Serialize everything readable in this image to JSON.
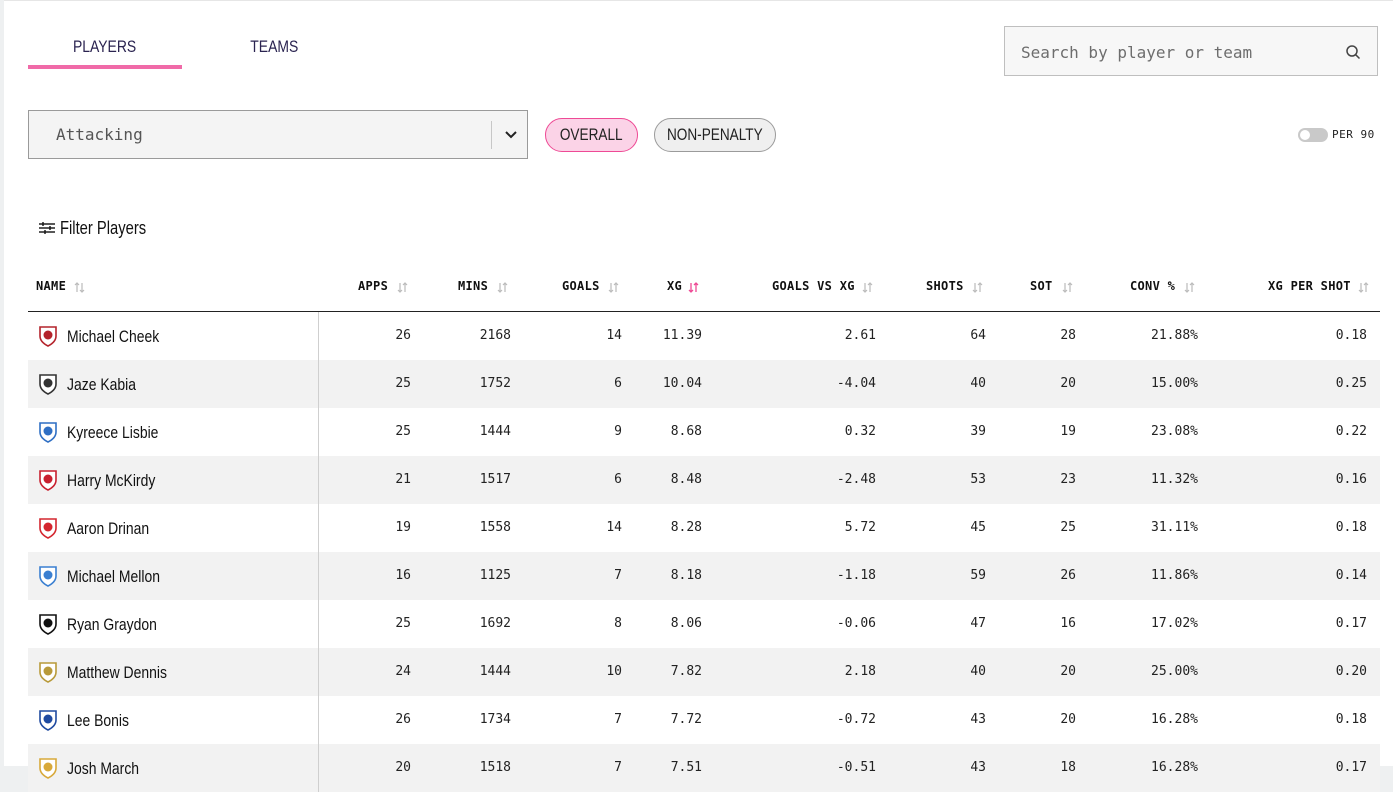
{
  "tabs": [
    {
      "label": "PLAYERS",
      "active": true
    },
    {
      "label": "TEAMS",
      "active": false
    }
  ],
  "search": {
    "placeholder": "Search by player or team"
  },
  "dropdown": {
    "selected": "Attacking"
  },
  "pills": {
    "overall": "OVERALL",
    "non_penalty": "NON-PENALTY"
  },
  "toggle": {
    "label": "PER 90",
    "on": false
  },
  "filter": {
    "label": "Filter Players"
  },
  "columns": {
    "name": "NAME",
    "apps": "APPS",
    "mins": "MINS",
    "goals": "GOALS",
    "xg": "XG",
    "goals_vs_xg": "GOALS VS XG",
    "shots": "SHOTS",
    "sot": "SOT",
    "conv": "CONV %",
    "xg_per_shot": "XG PER SHOT"
  },
  "sorted_by": "XG",
  "accent_color": "#ee4a95",
  "rows": [
    {
      "name": "Michael Cheek",
      "crest": "#b4232b",
      "apps": "26",
      "mins": "2168",
      "goals": "14",
      "xg": "11.39",
      "gvx": "2.61",
      "shots": "64",
      "sot": "28",
      "conv": "21.88%",
      "xgps": "0.18"
    },
    {
      "name": "Jaze Kabia",
      "crest": "#333333",
      "apps": "25",
      "mins": "1752",
      "goals": "6",
      "xg": "10.04",
      "gvx": "-4.04",
      "shots": "40",
      "sot": "20",
      "conv": "15.00%",
      "xgps": "0.25"
    },
    {
      "name": "Kyreece Lisbie",
      "crest": "#2f6fc4",
      "apps": "25",
      "mins": "1444",
      "goals": "9",
      "xg": "8.68",
      "gvx": "0.32",
      "shots": "39",
      "sot": "19",
      "conv": "23.08%",
      "xgps": "0.22"
    },
    {
      "name": "Harry McKirdy",
      "crest": "#c8202f",
      "apps": "21",
      "mins": "1517",
      "goals": "6",
      "xg": "8.48",
      "gvx": "-2.48",
      "shots": "53",
      "sot": "23",
      "conv": "11.32%",
      "xgps": "0.16"
    },
    {
      "name": "Aaron Drinan",
      "crest": "#d4262f",
      "apps": "19",
      "mins": "1558",
      "goals": "14",
      "xg": "8.28",
      "gvx": "5.72",
      "shots": "45",
      "sot": "25",
      "conv": "31.11%",
      "xgps": "0.18"
    },
    {
      "name": "Michael Mellon",
      "crest": "#3a7fd1",
      "apps": "16",
      "mins": "1125",
      "goals": "7",
      "xg": "8.18",
      "gvx": "-1.18",
      "shots": "59",
      "sot": "26",
      "conv": "11.86%",
      "xgps": "0.14"
    },
    {
      "name": "Ryan Graydon",
      "crest": "#111111",
      "apps": "25",
      "mins": "1692",
      "goals": "8",
      "xg": "8.06",
      "gvx": "-0.06",
      "shots": "47",
      "sot": "16",
      "conv": "17.02%",
      "xgps": "0.17"
    },
    {
      "name": "Matthew Dennis",
      "crest": "#b89a3a",
      "apps": "24",
      "mins": "1444",
      "goals": "10",
      "xg": "7.82",
      "gvx": "2.18",
      "shots": "40",
      "sot": "20",
      "conv": "25.00%",
      "xgps": "0.20"
    },
    {
      "name": "Lee Bonis",
      "crest": "#1f4aa0",
      "apps": "26",
      "mins": "1734",
      "goals": "7",
      "xg": "7.72",
      "gvx": "-0.72",
      "shots": "43",
      "sot": "20",
      "conv": "16.28%",
      "xgps": "0.18"
    },
    {
      "name": "Josh March",
      "crest": "#d8a93a",
      "apps": "20",
      "mins": "1518",
      "goals": "7",
      "xg": "7.51",
      "gvx": "-0.51",
      "shots": "43",
      "sot": "18",
      "conv": "16.28%",
      "xgps": "0.17"
    }
  ]
}
